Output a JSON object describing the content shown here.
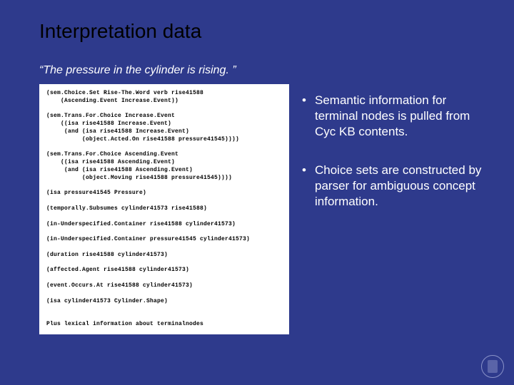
{
  "title": "Interpretation data",
  "subtitle": "“The pressure in the cylinder is rising. ”",
  "code": "(sem.Choice.Set Rise-The.Word verb rise41588\n    (Ascending.Event Increase.Event))\n\n(sem.Trans.For.Choice Increase.Event\n    ((isa rise41588 Increase.Event)\n     (and (isa rise41588 Increase.Event)\n          (object.Acted.On rise41588 pressure41545))))\n\n(sem.Trans.For.Choice Ascending.Event\n    ((isa rise41588 Ascending.Event)\n     (and (isa rise41588 Ascending.Event)\n          (object.Moving rise41588 pressure41545))))\n\n(isa pressure41545 Pressure)\n\n(temporally.Subsumes cylinder41573 rise41588)\n\n(in-Underspecified.Container rise41588 cylinder41573)\n\n(in-Underspecified.Container pressure41545 cylinder41573)\n\n(duration rise41588 cylinder41573)\n\n(affected.Agent rise41588 cylinder41573)\n\n(event.Occurs.At rise41588 cylinder41573)\n\n(isa cylinder41573 Cylinder.Shape)\n\n\nPlus lexical information about terminalnodes",
  "bullets": [
    "Semantic information for terminal nodes is pulled from Cyc KB contents.",
    "Choice sets are constructed by parser for ambiguous concept information."
  ]
}
